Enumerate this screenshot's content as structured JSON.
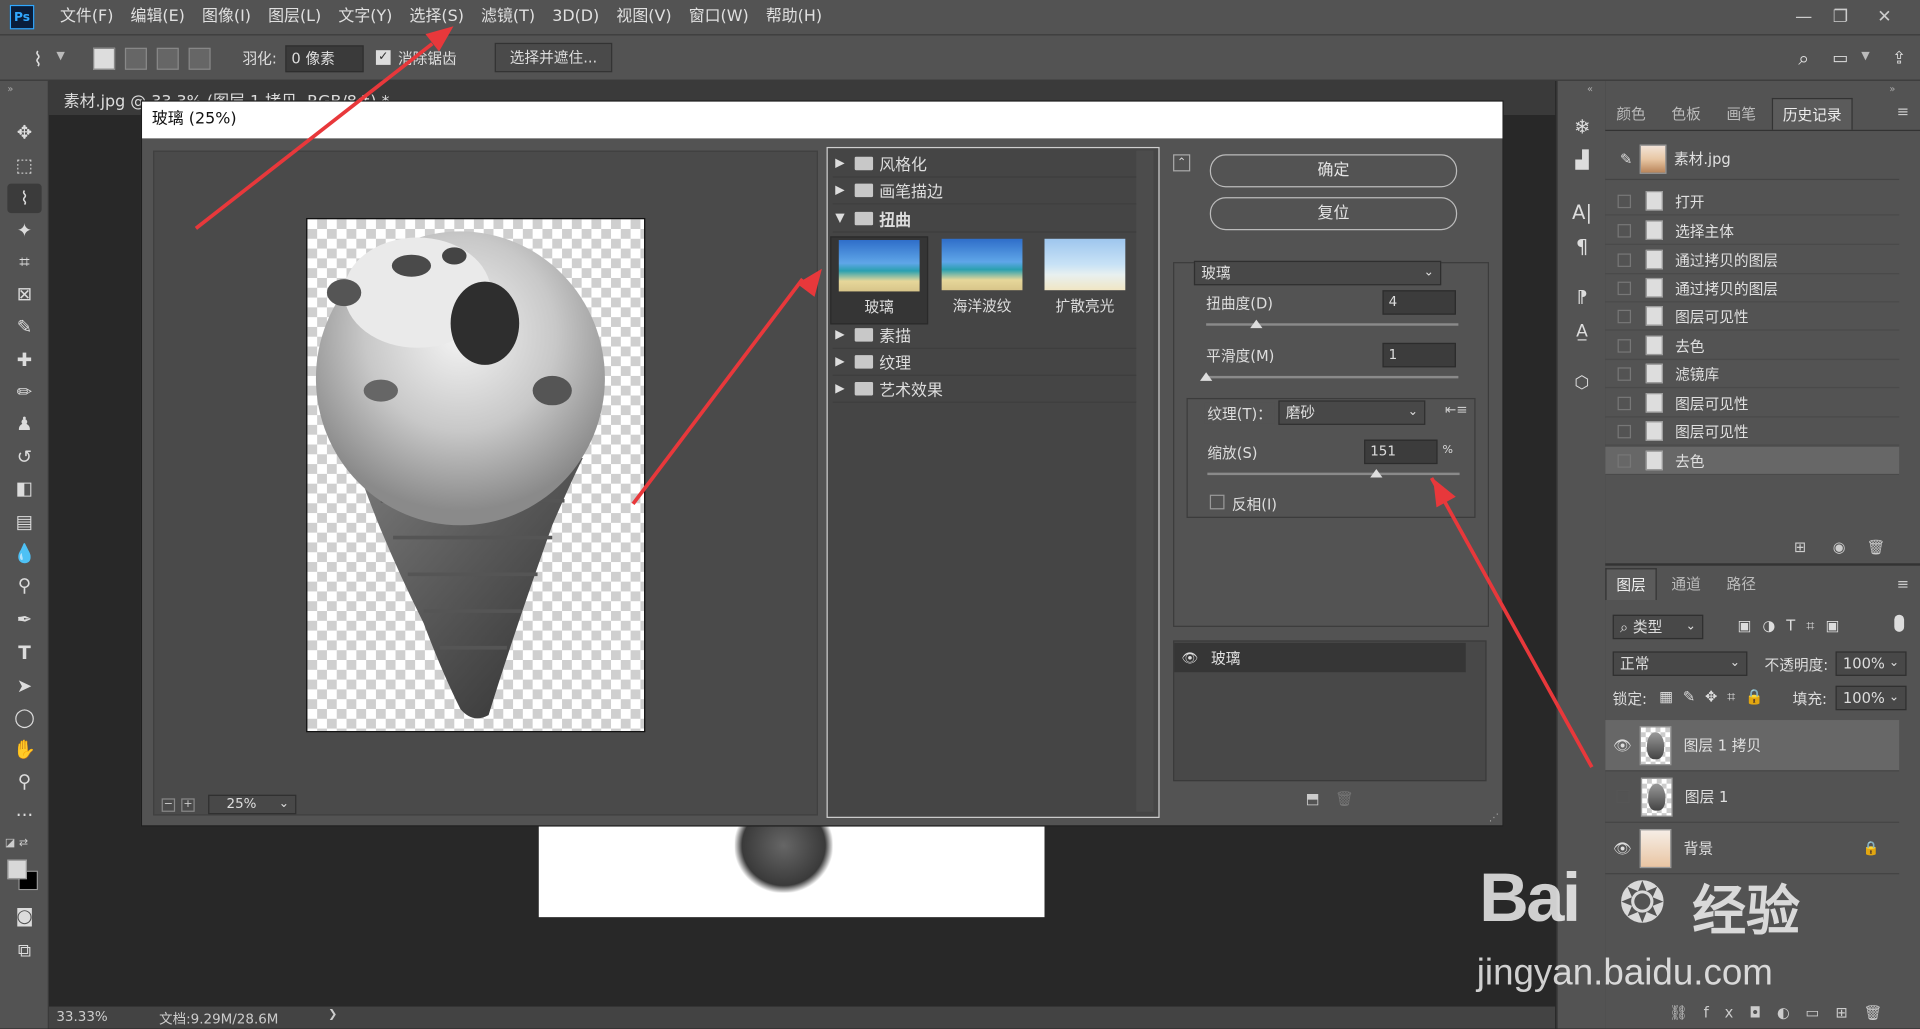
{
  "app": {
    "logo": "Ps"
  },
  "menu": [
    "文件(F)",
    "编辑(E)",
    "图像(I)",
    "图层(L)",
    "文字(Y)",
    "选择(S)",
    "滤镜(T)",
    "3D(D)",
    "视图(V)",
    "窗口(W)",
    "帮助(H)"
  ],
  "options": {
    "feather_label": "羽化:",
    "feather_value": "0 像素",
    "antialias_label": "消除锯齿",
    "select_mask_button": "选择并遮住..."
  },
  "document": {
    "tab_title": "素材.jpg @ 33.3% (图层 1 拷贝, RGB/8#) *",
    "zoom": "33.33%",
    "doc_info": "文档:9.29M/28.6M",
    "status_arrow": "❯"
  },
  "dialog": {
    "title": "玻璃 (25%)",
    "zoom_value": "25%",
    "categories": {
      "stylize": "风格化",
      "brush": "画笔描边",
      "distort": "扭曲",
      "sketch": "素描",
      "texture": "纹理",
      "artistic": "艺术效果"
    },
    "thumbnails": [
      "玻璃",
      "海洋波纹",
      "扩散亮光"
    ],
    "ok": "确定",
    "reset": "复位",
    "filter_select": "玻璃",
    "distortion_label": "扭曲度(D)",
    "distortion_value": "4",
    "distortion_level": 0.2,
    "smoothness_label": "平滑度(M)",
    "smoothness_value": "1",
    "smoothness_level": 0.0,
    "texture_label": "纹理(T)：",
    "texture_value": "磨砂",
    "scaling_label": "缩放(S)",
    "scaling_value": "151",
    "scaling_unit": "%",
    "scaling_level": 0.67,
    "invert_label": "反相(I)",
    "effect_layer": "玻璃"
  },
  "panels": {
    "tabs_top": [
      "颜色",
      "色板",
      "画笔",
      "历史记录"
    ],
    "history_source": "素材.jpg",
    "history": [
      "打开",
      "选择主体",
      "通过拷贝的图层",
      "通过拷贝的图层",
      "图层可见性",
      "去色",
      "滤镜库",
      "图层可见性",
      "图层可见性",
      "去色"
    ],
    "tabs_layers": [
      "图层",
      "通道",
      "路径"
    ],
    "filter_kind": "类型",
    "blend_mode": "正常",
    "opacity_label": "不透明度:",
    "opacity_value": "100%",
    "lock_label": "锁定:",
    "fill_label": "填充:",
    "fill_value": "100%",
    "layers": [
      "图层 1 拷贝",
      "图层 1",
      "背景"
    ]
  },
  "watermark": {
    "brand_a": "Bai",
    "brand_b": "经验",
    "url": "jingyan.baidu.com"
  },
  "colors": {
    "ui_dark": "#535353",
    "canvas": "#282828",
    "annotation": "#e8383b",
    "accent_selected": "#676767"
  }
}
